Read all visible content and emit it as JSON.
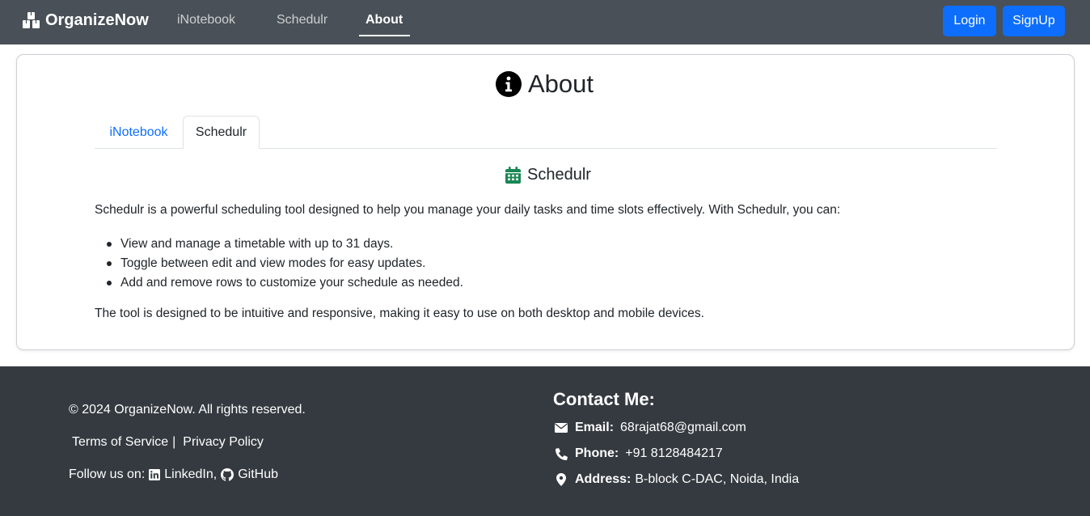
{
  "navbar": {
    "brand": "OrganizeNow",
    "links": [
      "iNotebook",
      "Schedulr",
      "About"
    ],
    "active_link": "About",
    "login_label": "Login",
    "signup_label": "SignUp"
  },
  "about": {
    "title": "About",
    "tabs": [
      "iNotebook",
      "Schedulr"
    ],
    "active_tab": "Schedulr",
    "section_title": "Schedulr",
    "intro": "Schedulr is a powerful scheduling tool designed to help you manage your daily tasks and time slots effectively. With Schedulr, you can:",
    "features": [
      "View and manage a timetable with up to 31 days.",
      "Toggle between edit and view modes for easy updates.",
      "Add and remove rows to customize your schedule as needed."
    ],
    "outro": "The tool is designed to be intuitive and responsive, making it easy to use on both desktop and mobile devices."
  },
  "footer": {
    "copyright": "© 2024 OrganizeNow. All rights reserved.",
    "terms": "Terms of Service",
    "separator": "|",
    "privacy": "Privacy Policy",
    "follow_label": "Follow us on:",
    "linkedin": "LinkedIn,",
    "github": "GitHub",
    "contact_title": "Contact Me:",
    "email_label": "Email:",
    "email": "68rajat68@gmail.com",
    "phone_label": "Phone:",
    "phone": "+91 8128484217",
    "address_label": "Address:",
    "address": "B-block C-DAC, Noida, India"
  },
  "colors": {
    "navbar_bg": "#495057",
    "footer_bg": "#343a40",
    "primary": "#0d6efd",
    "calendar_icon": "#198754"
  },
  "icons": {
    "brand": "cubes-icon",
    "title": "info-circle-icon",
    "section": "calendar-icon",
    "linkedin": "linkedin-icon",
    "github": "github-icon",
    "email": "envelope-icon",
    "phone": "phone-icon",
    "address": "map-pin-icon"
  }
}
